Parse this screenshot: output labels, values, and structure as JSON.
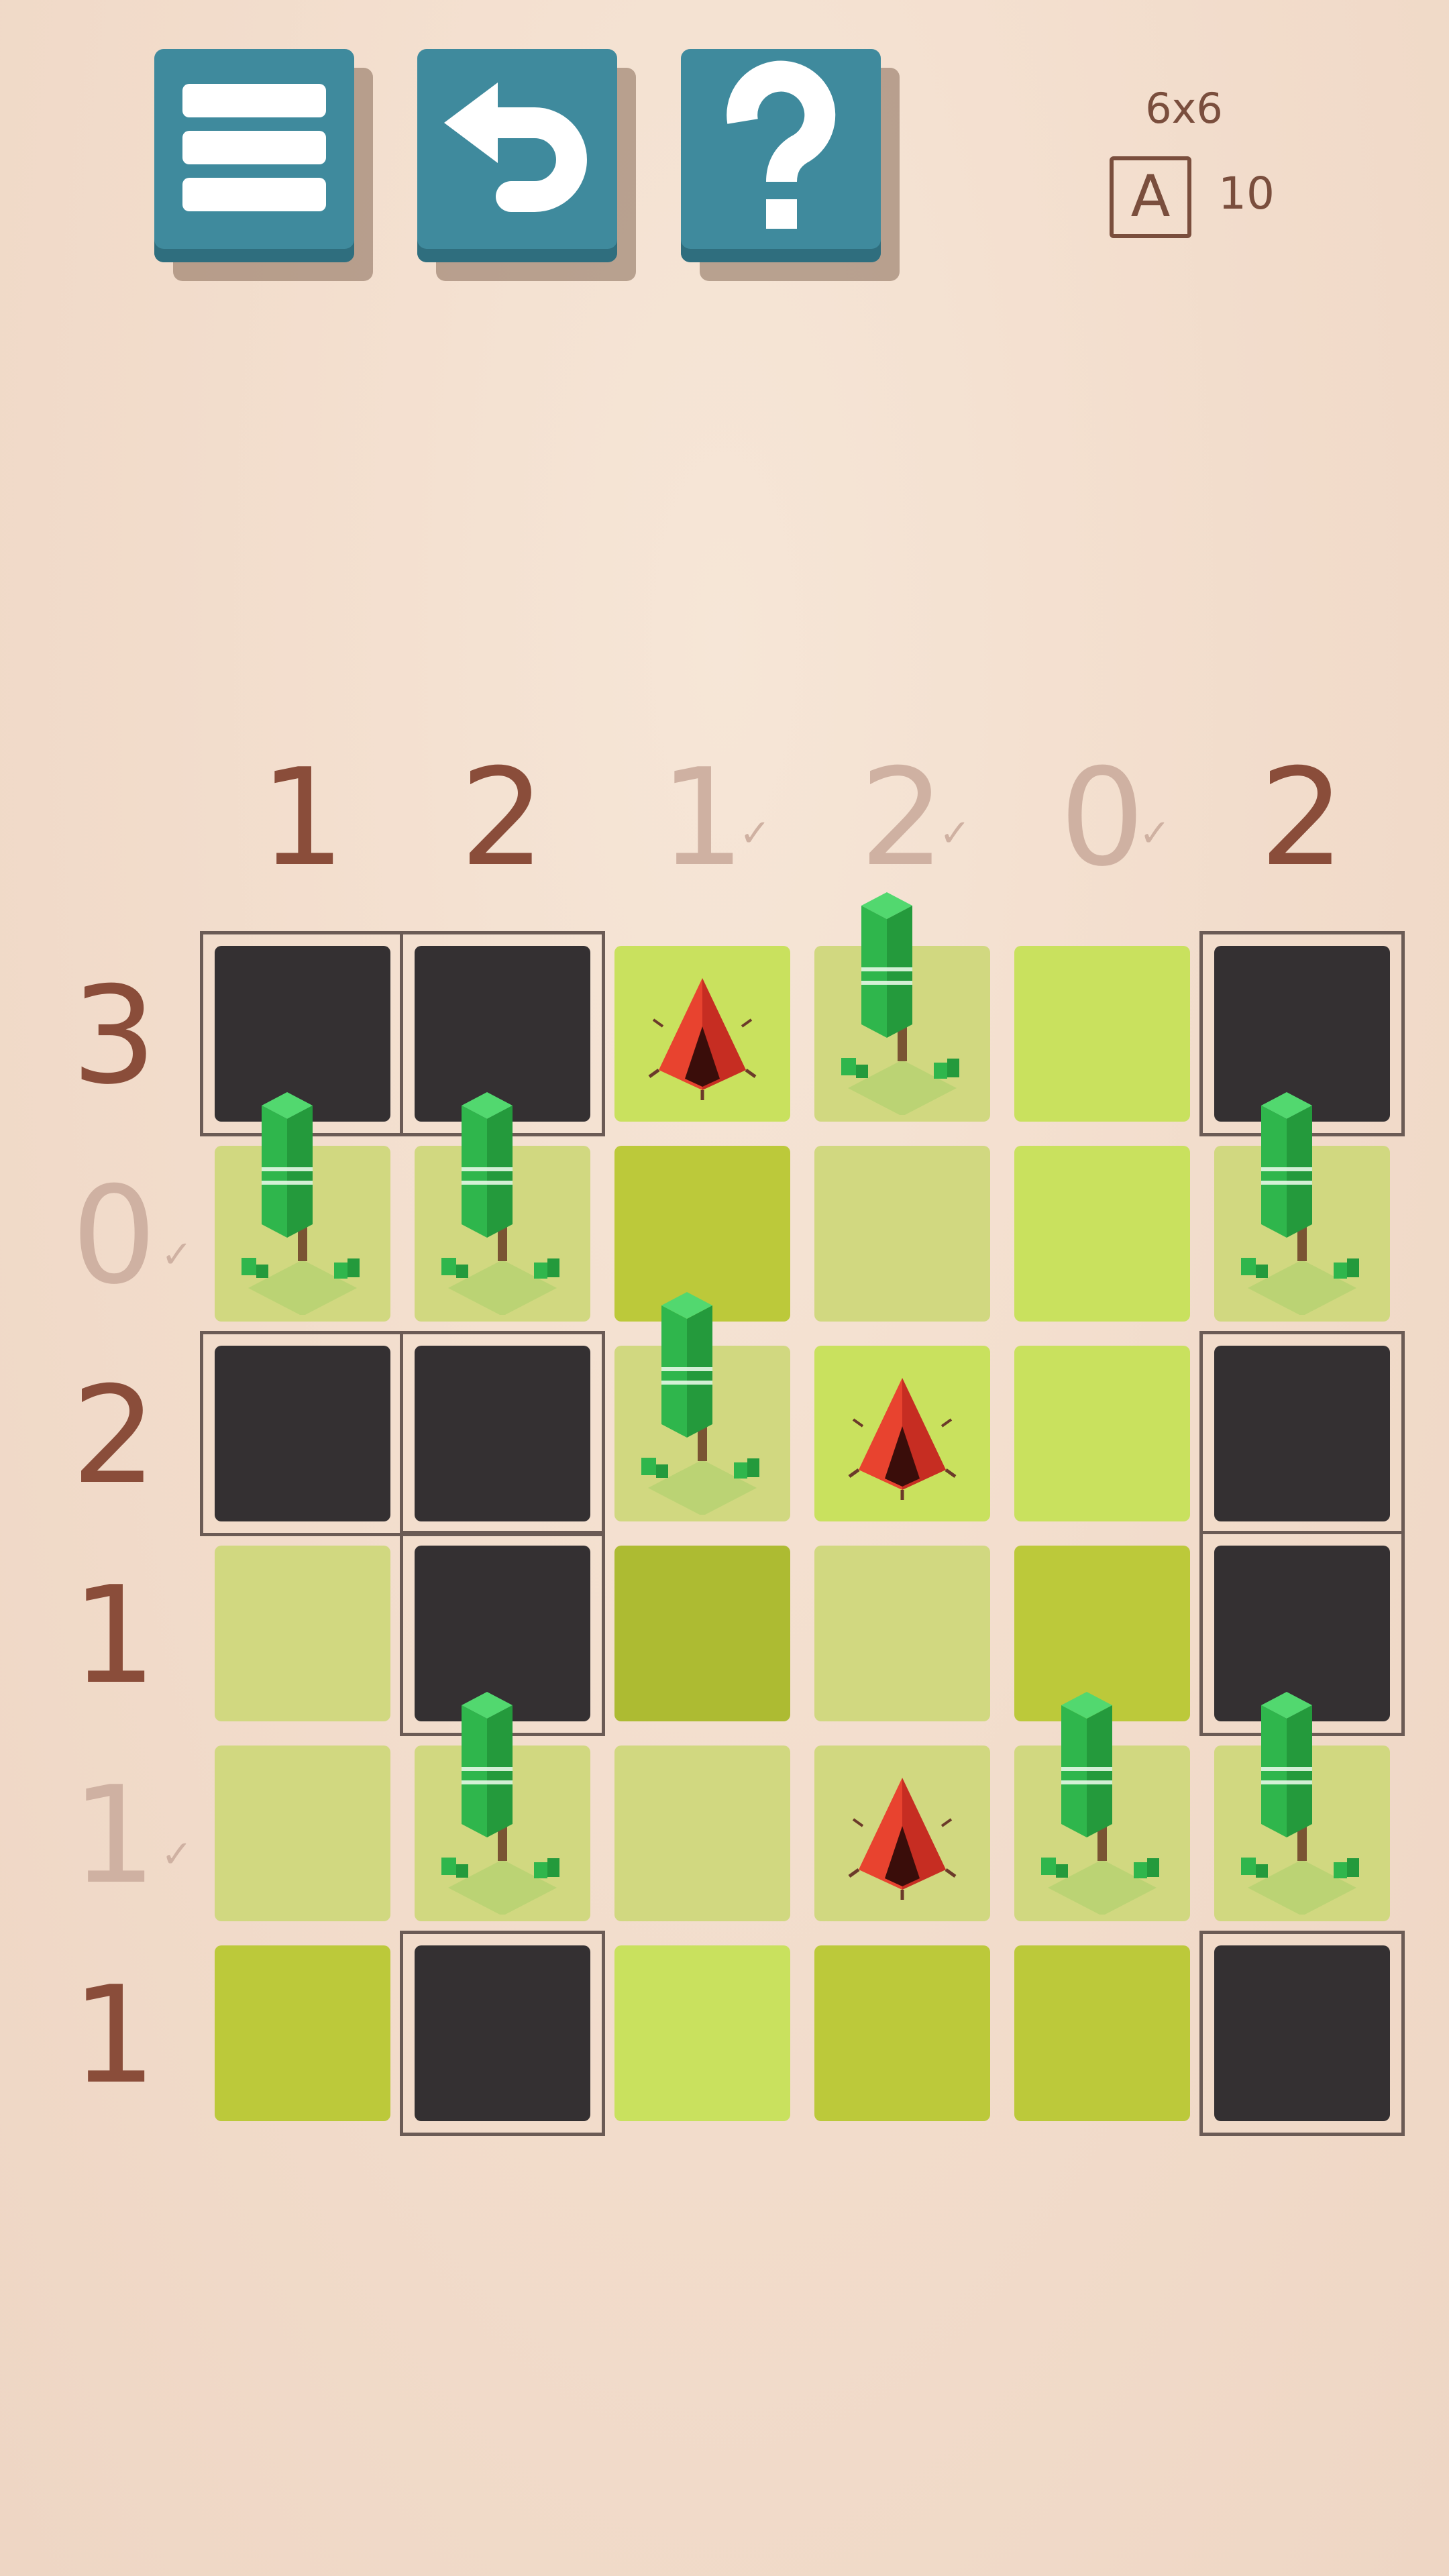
{
  "toolbar": {
    "menu_icon": "hamburger-menu-icon",
    "undo_icon": "undo-arrow-icon",
    "help_icon": "question-mark-icon"
  },
  "info": {
    "size": "6x6",
    "badge_letter": "A",
    "count": "10"
  },
  "colors": {
    "button": "#3f8a9d",
    "clue_active": "#8a4d3a",
    "clue_done": "#cfb1a2",
    "blocked_cell": "#343032"
  },
  "column_clues": [
    {
      "value": "1",
      "done": false
    },
    {
      "value": "2",
      "done": false
    },
    {
      "value": "1",
      "done": true
    },
    {
      "value": "2",
      "done": true
    },
    {
      "value": "0",
      "done": true
    },
    {
      "value": "2",
      "done": false
    }
  ],
  "row_clues": [
    {
      "value": "3",
      "done": false
    },
    {
      "value": "0",
      "done": true
    },
    {
      "value": "2",
      "done": false
    },
    {
      "value": "1",
      "done": false
    },
    {
      "value": "1",
      "done": true
    },
    {
      "value": "1",
      "done": false
    }
  ],
  "check_mark": "✓",
  "grid": [
    [
      {
        "state": "blocked"
      },
      {
        "state": "blocked"
      },
      {
        "state": "tent",
        "color": "#c9e15e"
      },
      {
        "state": "tree",
        "color": "#d1d880"
      },
      {
        "state": "empty",
        "color": "#c9e15e"
      },
      {
        "state": "blocked"
      }
    ],
    [
      {
        "state": "tree",
        "color": "#d1d880"
      },
      {
        "state": "tree",
        "color": "#d1d880"
      },
      {
        "state": "empty",
        "color": "#bcc93a"
      },
      {
        "state": "empty",
        "color": "#d1d880"
      },
      {
        "state": "empty",
        "color": "#c9e15e"
      },
      {
        "state": "tree",
        "color": "#d1d880"
      }
    ],
    [
      {
        "state": "blocked"
      },
      {
        "state": "blocked"
      },
      {
        "state": "tree",
        "color": "#d1d880"
      },
      {
        "state": "tent",
        "color": "#c9e15e"
      },
      {
        "state": "empty",
        "color": "#c9e15e"
      },
      {
        "state": "blocked"
      }
    ],
    [
      {
        "state": "empty",
        "color": "#d1d880"
      },
      {
        "state": "blocked"
      },
      {
        "state": "empty",
        "color": "#adbb32"
      },
      {
        "state": "empty",
        "color": "#d1d880"
      },
      {
        "state": "empty",
        "color": "#bcc93a"
      },
      {
        "state": "blocked"
      }
    ],
    [
      {
        "state": "empty",
        "color": "#d1d880"
      },
      {
        "state": "tree",
        "color": "#d1d880"
      },
      {
        "state": "empty",
        "color": "#d1d880"
      },
      {
        "state": "tent",
        "color": "#d1d880"
      },
      {
        "state": "tree",
        "color": "#d1d880"
      },
      {
        "state": "tree",
        "color": "#d1d880"
      }
    ],
    [
      {
        "state": "empty",
        "color": "#bcc93a"
      },
      {
        "state": "blocked"
      },
      {
        "state": "empty",
        "color": "#c9e15e"
      },
      {
        "state": "empty",
        "color": "#bcc93a"
      },
      {
        "state": "empty",
        "color": "#bcc93a"
      },
      {
        "state": "blocked"
      }
    ]
  ],
  "blocked_regions": [
    {
      "row": 0,
      "col": 0,
      "rows": 1,
      "cols": 2
    },
    {
      "row": 0,
      "col": 5,
      "rows": 1,
      "cols": 1
    },
    {
      "row": 2,
      "col": 0,
      "rows": 1,
      "cols": 2
    },
    {
      "row": 2,
      "col": 5,
      "rows": 2,
      "cols": 1
    },
    {
      "row": 3,
      "col": 1,
      "rows": 1,
      "cols": 1
    },
    {
      "row": 5,
      "col": 1,
      "rows": 1,
      "cols": 1
    },
    {
      "row": 5,
      "col": 5,
      "rows": 1,
      "cols": 1
    }
  ]
}
